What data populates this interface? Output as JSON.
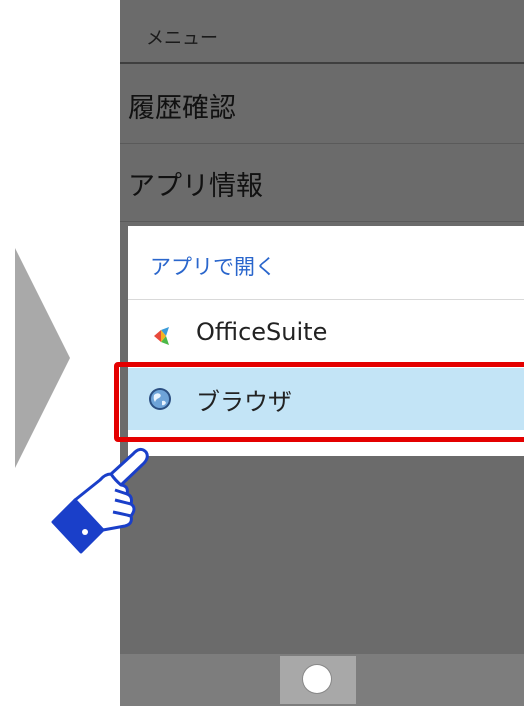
{
  "menu": {
    "header": "メニュー",
    "items": [
      {
        "label": "履歴確認"
      },
      {
        "label": "アプリ情報"
      }
    ]
  },
  "dialog": {
    "title": "アプリで開く",
    "apps": [
      {
        "name": "OfficeSuite",
        "icon": "officesuite-icon",
        "selected": false
      },
      {
        "name": "ブラウザ",
        "icon": "browser-globe-icon",
        "selected": true
      }
    ]
  },
  "colors": {
    "dialog_title": "#2a66cc",
    "selected_row": "#c3e4f6",
    "highlight_border": "#e40000",
    "pointer_hand": "#1a3fc9"
  }
}
